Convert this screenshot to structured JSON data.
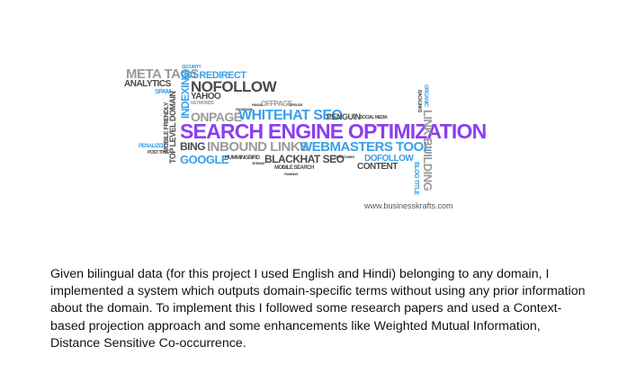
{
  "colors": {
    "gray": "#9a9a9a",
    "dark": "#4a4a4a",
    "blue": "#3aa0e6",
    "purple": "#8a3ff0"
  },
  "cloud": {
    "meta_tags": "META TAGS",
    "security": "SECURITY",
    "redirect": "301 REDIRECT",
    "analytics": "ANALYTICS",
    "spam": "SPAM",
    "nofollow": "NOFOLLOW",
    "yahoo": "YAHOO",
    "keywords": "KEYWORDS",
    "offpage": "OFFPAGE",
    "episode": "EPISODE",
    "panda": "PANDA",
    "pagerank": "PAGERANK",
    "onpage": "ONPAGE",
    "whitehat": "WHITEHAT SEO",
    "penguin": "PENGUIN",
    "social": "SOCIAL MEDIA",
    "seo": "SEARCH ENGINE OPTIMIZATION",
    "penalized": "PENALIZED",
    "post_title": "POST TITLE",
    "bing": "BING",
    "inbound": "INBOUND LINKS",
    "webmasters": "WEBMASTERS TOOL",
    "google": "GOOGLE",
    "hummingbird": "HUMMINGBIRD",
    "sitemap": "SITEMAP",
    "blackhat": "BLACKHAT SEO",
    "directories": "DIRECTORIES",
    "dofollow": "DOFOLLOW",
    "mobile_search": "MOBILE SEARCH",
    "content": "CONTENT",
    "ranking": "RANKING",
    "v_mobile_friendly": "MOBILE FRIENDLY",
    "v_top_level": "TOP LEVEL DOMAIN",
    "v_indexing": "INDEXING",
    "v_organic": "ORGANIC",
    "v_backlinks": "BACKLINKS",
    "v_link_building": "LINK BUILDING",
    "v_blog_title": "BLOG TITLE",
    "watermark": "www.businesskrafts.com"
  },
  "paragraph": "Given bilingual data (for this project I used English and Hindi) belonging to any domain, I implemented a system which outputs domain-specific terms without using any prior information about the domain. To implement this I followed some research papers and used a Context-based projection approach and some enhancements like Weighted Mutual Information, Distance Sensitive Co-occurrence."
}
